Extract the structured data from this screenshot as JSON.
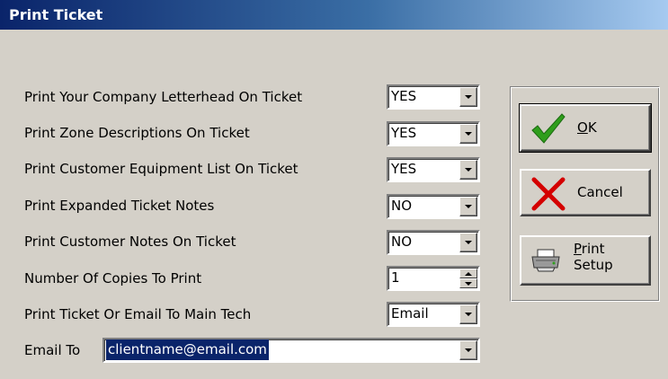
{
  "window": {
    "title": "Print Ticket"
  },
  "options": [
    {
      "label": "Print Your Company Letterhead On Ticket",
      "value": "YES"
    },
    {
      "label": "Print Zone Descriptions On Ticket",
      "value": "YES"
    },
    {
      "label": "Print Customer Equipment List On Ticket",
      "value": "YES"
    },
    {
      "label": "Print Expanded Ticket Notes",
      "value": "NO"
    },
    {
      "label": "Print Customer Notes On Ticket",
      "value": "NO"
    },
    {
      "label": "Number Of Copies To Print",
      "value": "1"
    },
    {
      "label": "Print Ticket Or Email To Main Tech",
      "value": "Email"
    }
  ],
  "email": {
    "label": "Email To",
    "value": "clientname@email.com"
  },
  "buttons": {
    "ok": {
      "mnemonic": "O",
      "rest": "K"
    },
    "cancel": {
      "label": "Cancel"
    },
    "print_setup": {
      "line1_mnemonic": "P",
      "line1_rest": "rint",
      "line2": "Setup"
    }
  },
  "icons": {
    "ok": "checkmark-icon",
    "cancel": "red-x-icon",
    "print_setup": "printer-icon"
  },
  "colors": {
    "check": "#2f9e1c",
    "x": "#d40000",
    "title_start": "#0a246a"
  }
}
